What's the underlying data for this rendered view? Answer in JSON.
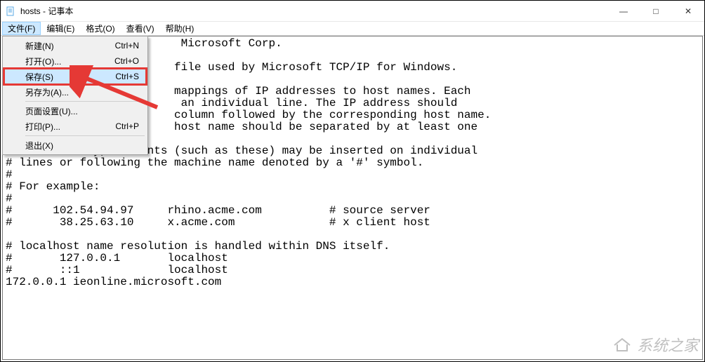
{
  "window": {
    "title": "hosts - 记事本"
  },
  "win_controls": {
    "minimize": "—",
    "maximize": "□",
    "close": "✕"
  },
  "menubar": {
    "file": "文件(F)",
    "edit": "编辑(E)",
    "format": "格式(O)",
    "view": "查看(V)",
    "help": "帮助(H)"
  },
  "file_menu": {
    "new": {
      "label": "新建(N)",
      "shortcut": "Ctrl+N"
    },
    "open": {
      "label": "打开(O)...",
      "shortcut": "Ctrl+O"
    },
    "save": {
      "label": "保存(S)",
      "shortcut": "Ctrl+S"
    },
    "save_as": {
      "label": "另存为(A)...",
      "shortcut": ""
    },
    "page_setup": {
      "label": "页面设置(U)...",
      "shortcut": ""
    },
    "print": {
      "label": "打印(P)...",
      "shortcut": "Ctrl+P"
    },
    "exit": {
      "label": "退出(X)",
      "shortcut": ""
    }
  },
  "editor": {
    "text": "                          Microsoft Corp.\n\n                         file used by Microsoft TCP/IP for Windows.\n\n                         mappings of IP addresses to host names. Each\n                          an individual line. The IP address should\n                         column followed by the corresponding host name.\n                         host name should be separated by at least one\n\n# Additionally, comments (such as these) may be inserted on individual\n# lines or following the machine name denoted by a '#' symbol.\n#\n# For example:\n#\n#      102.54.94.97     rhino.acme.com          # source server\n#       38.25.63.10     x.acme.com              # x client host\n\n# localhost name resolution is handled within DNS itself.\n#       127.0.0.1       localhost\n#       ::1             localhost\n172.0.0.1 ieonline.microsoft.com"
  },
  "watermark": {
    "text": "系统之家"
  }
}
